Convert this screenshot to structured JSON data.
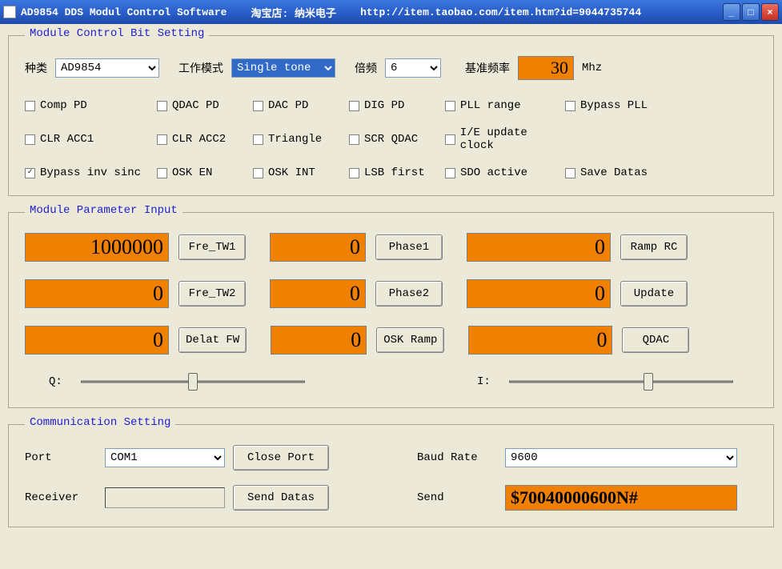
{
  "titlebar": {
    "app_title": "AD9854 DDS Modul Control Software",
    "shop": "淘宝店: 纳米电子",
    "url": "http://item.taobao.com/item.htm?id=9044735744"
  },
  "group1": {
    "legend": "Module Control Bit Setting",
    "type_label": "种类",
    "type_value": "AD9854",
    "mode_label": "工作模式",
    "mode_value": "Single tone",
    "mult_label": "倍频",
    "mult_value": "6",
    "refclk_label": "基准频率",
    "refclk_value": "30",
    "refclk_unit": "Mhz",
    "checks": [
      {
        "label": "Comp PD",
        "checked": false
      },
      {
        "label": "QDAC PD",
        "checked": false
      },
      {
        "label": "DAC PD",
        "checked": false
      },
      {
        "label": "DIG PD",
        "checked": false
      },
      {
        "label": "PLL range",
        "checked": false
      },
      {
        "label": "Bypass PLL",
        "checked": false
      },
      {
        "label": "CLR ACC1",
        "checked": false
      },
      {
        "label": "CLR ACC2",
        "checked": false
      },
      {
        "label": "Triangle",
        "checked": false
      },
      {
        "label": "SCR QDAC",
        "checked": false
      },
      {
        "label": "I/E update clock",
        "checked": false
      },
      {
        "label": "",
        "checked": false,
        "empty": true
      },
      {
        "label": "Bypass inv sinc",
        "checked": true
      },
      {
        "label": "OSK EN",
        "checked": false
      },
      {
        "label": "OSK INT",
        "checked": false
      },
      {
        "label": "LSB first",
        "checked": false
      },
      {
        "label": "SDO active",
        "checked": false
      },
      {
        "label": "Save Datas",
        "checked": false
      }
    ]
  },
  "group2": {
    "legend": "Module Parameter Input",
    "rows": [
      {
        "f1": "1000000",
        "b1": "Fre_TW1",
        "f2": "0",
        "b2": "Phase1",
        "f3": "0",
        "b3": "Ramp RC"
      },
      {
        "f1": "0",
        "b1": "Fre_TW2",
        "f2": "0",
        "b2": "Phase2",
        "f3": "0",
        "b3": "Update"
      },
      {
        "f1": "0",
        "b1": "Delat FW",
        "f2": "0",
        "b2": "OSK Ramp",
        "f3": "0",
        "b3": "QDAC"
      }
    ],
    "q_label": "Q:",
    "i_label": "I:"
  },
  "group3": {
    "legend": "Communication Setting",
    "port_label": "Port",
    "port_value": "COM1",
    "close_port_btn": "Close Port",
    "baud_label": "Baud Rate",
    "baud_value": "9600",
    "receiver_label": "Receiver",
    "receiver_value": "",
    "send_btn": "Send Datas",
    "send_label": "Send",
    "send_value": "$70040000600N#"
  }
}
